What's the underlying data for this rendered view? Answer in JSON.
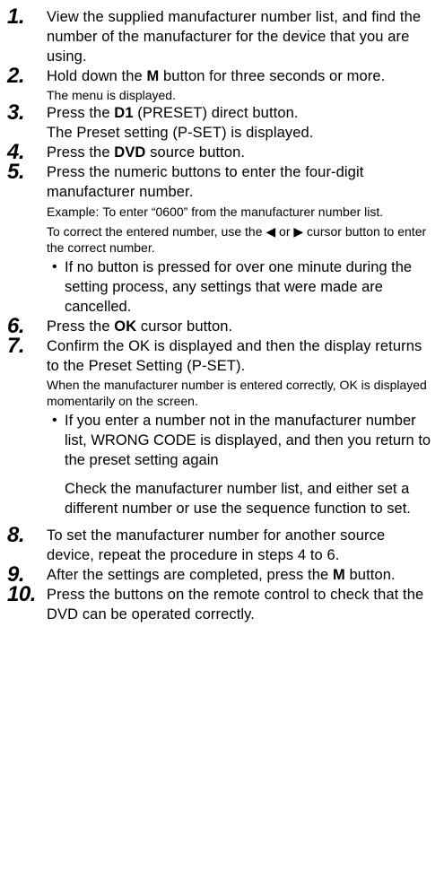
{
  "steps": [
    {
      "num": "1.",
      "text": "View the supplied manufacturer number list, and find the number of the manufacturer for the device that you are using."
    },
    {
      "num": "2.",
      "pre": "Hold down the ",
      "bold": "M",
      "post": " button for three seconds or more.",
      "note": "The menu is displayed."
    },
    {
      "num": "3.",
      "pre": "Press the ",
      "bold": "D1",
      "post": " (PRESET) direct button.",
      "line2": "The Preset setting (P-SET) is displayed."
    },
    {
      "num": "4.",
      "pre": "Press the ",
      "bold": "DVD",
      "post": " source button."
    },
    {
      "num": "5.",
      "text": "Press the numeric buttons to enter the four-digit manufacturer number.",
      "example_label": "Example:",
      "example_text": "To enter “0600” from the manufacturer number list.",
      "correct_pre": "To correct the entered number, use the ",
      "left_arrow": "◀",
      "or": " or ",
      "right_arrow": "▶",
      "correct_post": " cursor button to enter the correct number.",
      "bullet_symbol": "•",
      "bullet": "If no button is pressed for over one minute during the setting process, any settings that were made are cancelled."
    },
    {
      "num": "6.",
      "pre": "Press the ",
      "bold": "OK",
      "post": " cursor button."
    },
    {
      "num": "7.",
      "text": "Confirm the OK is displayed and then the display returns to the Preset Setting (P-SET).",
      "note": "When the manufacturer number is entered correctly, OK is displayed momentarily on the screen.",
      "bullet_symbol": "•",
      "bullet": "If you enter a number not in the manufacturer number list, WRONG CODE is displayed, and then you return to the preset setting again",
      "para": "Check the manufacturer number list, and either set a different number or use the sequence function to set."
    },
    {
      "num": "8.",
      "text": "To set the manufacturer number for another source device, repeat the procedure in steps 4 to 6."
    },
    {
      "num": "9.",
      "pre": "After the settings are completed, press the ",
      "bold": "M",
      "post": " button."
    },
    {
      "num": "10.",
      "text": "Press the buttons on the remote control to check that the DVD can be operated correctly."
    }
  ]
}
